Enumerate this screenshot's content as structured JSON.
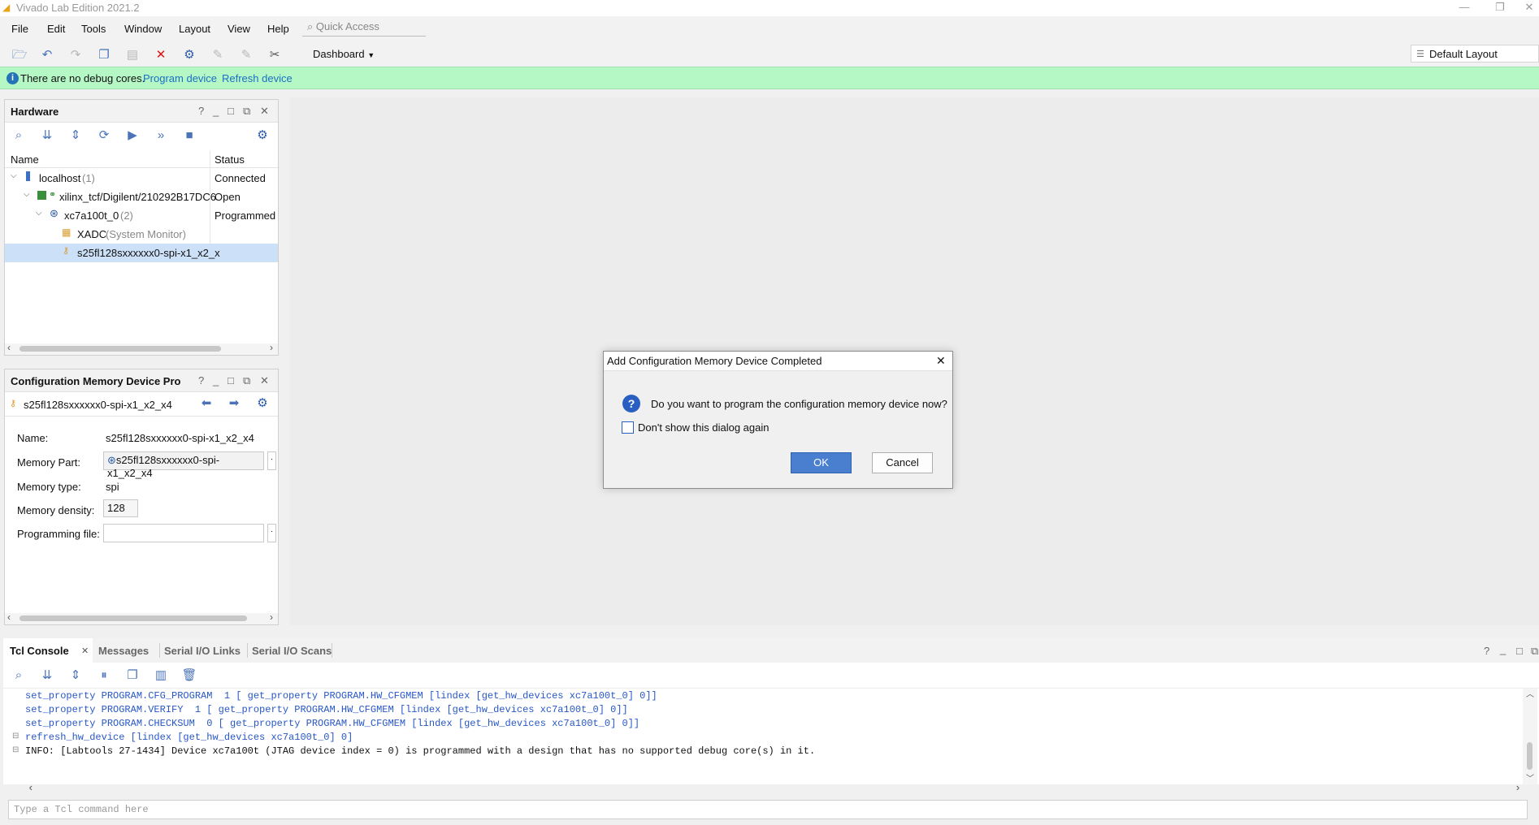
{
  "window": {
    "title": "Vivado Lab Edition 2021.2",
    "minimize": "—",
    "restore": "❐",
    "close": "✕"
  },
  "menu": [
    "File",
    "Edit",
    "Tools",
    "Window",
    "Layout",
    "View",
    "Help"
  ],
  "quick_access": {
    "placeholder": "Quick Access"
  },
  "toolbar": {
    "dashboard_label": "Dashboard",
    "layout_label": "Default Layout"
  },
  "banner": {
    "message": "There are no debug cores.",
    "program_link": "Program device",
    "refresh_link": "Refresh device"
  },
  "hardware": {
    "title": "Hardware",
    "columns": {
      "name": "Name",
      "status": "Status"
    },
    "rows": [
      {
        "name": "localhost",
        "extra": "(1)",
        "status": "Connected"
      },
      {
        "name": "xilinx_tcf/Digilent/210292B17DC6",
        "extra": "",
        "status": "Open"
      },
      {
        "name": "xc7a100t_0",
        "extra": "(2)",
        "status": "Programmed"
      },
      {
        "name": "XADC",
        "extra": "(System Monitor)",
        "status": ""
      },
      {
        "name": "s25fl128sxxxxxx0-spi-x1_x2_x",
        "extra": "",
        "status": ""
      }
    ]
  },
  "config_panel": {
    "title": "Configuration Memory Device Pro",
    "device": "s25fl128sxxxxxx0-spi-x1_x2_x4",
    "fields": {
      "name_label": "Name:",
      "name_value": "s25fl128sxxxxxx0-spi-x1_x2_x4",
      "part_label": "Memory Part:",
      "part_value": "s25fl128sxxxxxx0-spi-x1_x2_x4",
      "type_label": "Memory type:",
      "type_value": "spi",
      "density_label": "Memory density:",
      "density_value": "128",
      "file_label": "Programming file:",
      "file_value": ""
    }
  },
  "dialog": {
    "title": "Add Configuration Memory Device Completed",
    "question": "Do you want to program the configuration memory device now?",
    "checkbox": "Don't show this dialog again",
    "ok": "OK",
    "cancel": "Cancel"
  },
  "bottom_tabs": [
    "Tcl Console",
    "Messages",
    "Serial I/O Links",
    "Serial I/O Scans"
  ],
  "console": {
    "lines": [
      "set_property PROGRAM.CFG_PROGRAM  1 [ get_property PROGRAM.HW_CFGMEM [lindex [get_hw_devices xc7a100t_0] 0]]",
      "set_property PROGRAM.VERIFY  1 [ get_property PROGRAM.HW_CFGMEM [lindex [get_hw_devices xc7a100t_0] 0]]",
      "set_property PROGRAM.CHECKSUM  0 [ get_property PROGRAM.HW_CFGMEM [lindex [get_hw_devices xc7a100t_0] 0]]",
      "refresh_hw_device [lindex [get_hw_devices xc7a100t_0] 0]",
      "INFO: [Labtools 27-1434] Device xc7a100t (JTAG device index = 0) is programmed with a design that has no supported debug core(s) in it."
    ],
    "input_placeholder": "Type a Tcl command here"
  },
  "colors": {
    "banner": "#b6f7c6",
    "accent": "#4a7fd0",
    "link": "#1a6fc4"
  }
}
